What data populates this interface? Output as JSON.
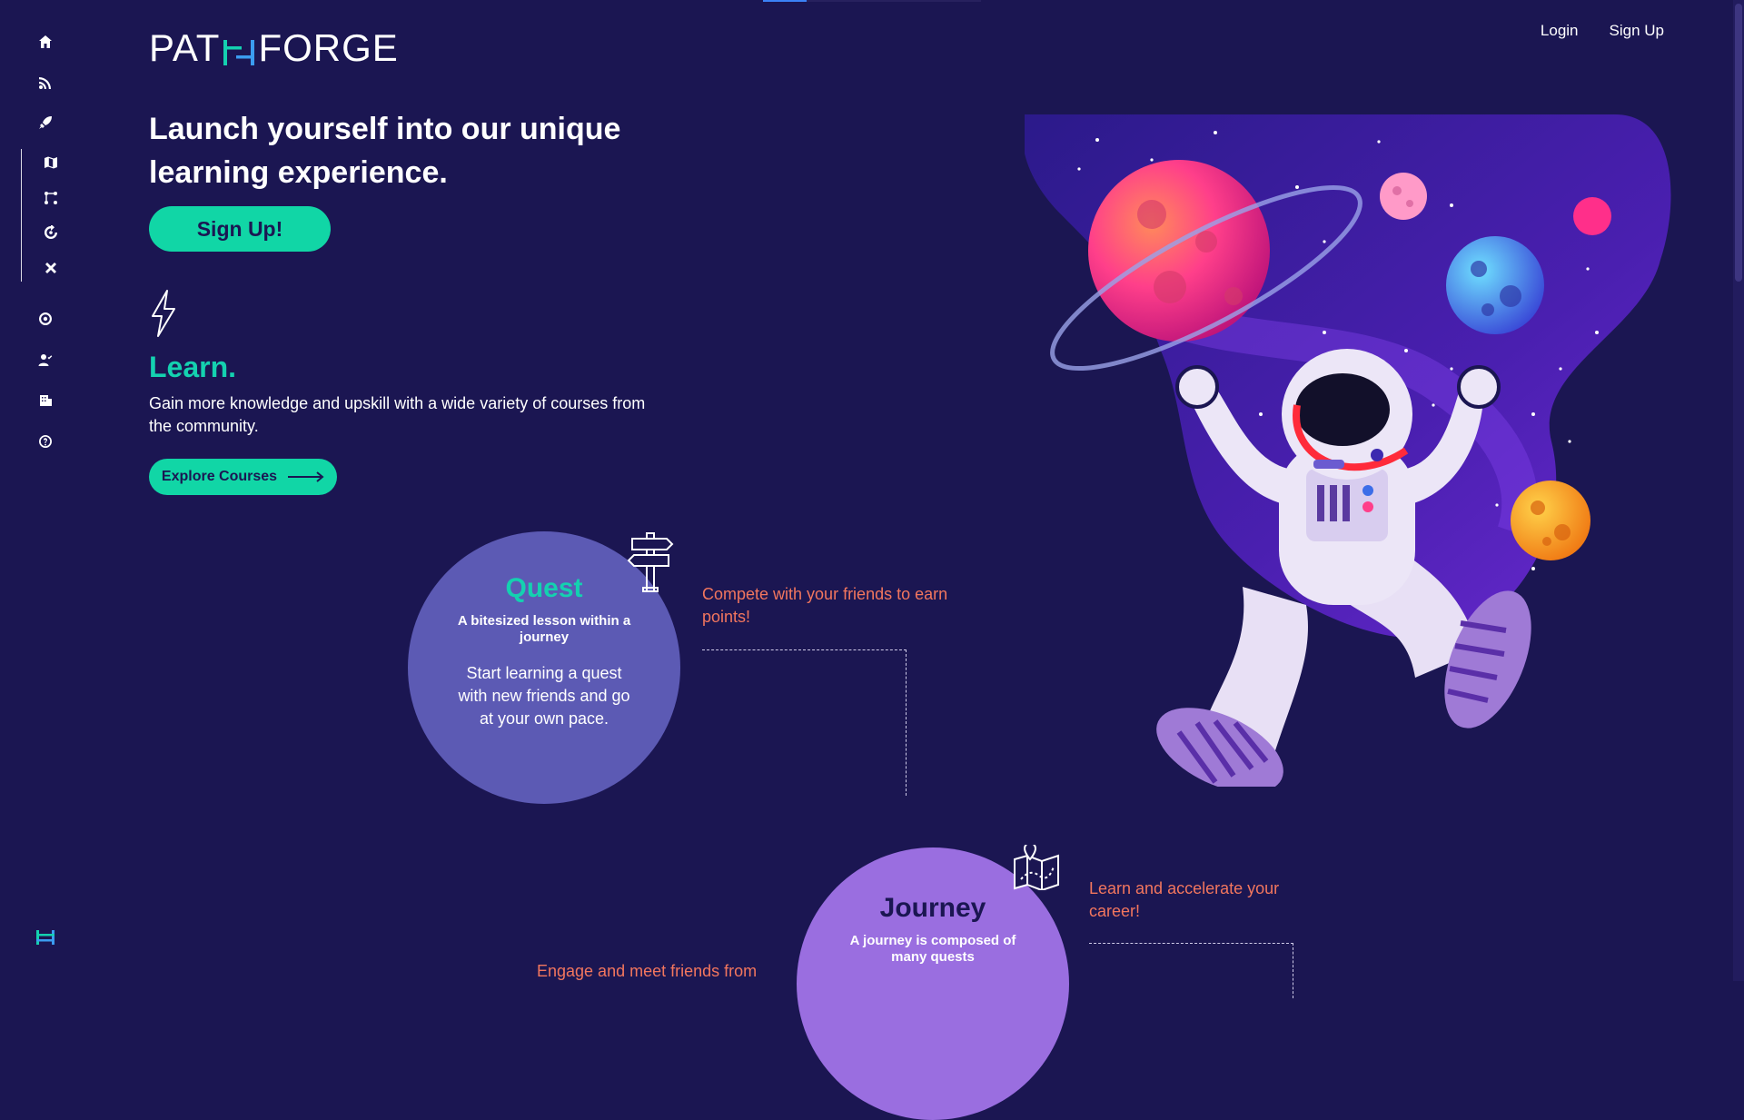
{
  "brand": {
    "logo_left": "PAT",
    "logo_right": "FORGE"
  },
  "nav": {
    "login": "Login",
    "signup": "Sign Up"
  },
  "sidebar": {
    "items": [
      {
        "icon": "home-icon"
      },
      {
        "icon": "rss-icon"
      },
      {
        "icon": "rocket-icon"
      },
      {
        "icon": "map-icon"
      },
      {
        "icon": "path-icon"
      },
      {
        "icon": "refresh-icon"
      },
      {
        "icon": "tools-icon"
      },
      {
        "icon": "target-icon"
      },
      {
        "icon": "user-check-icon"
      },
      {
        "icon": "building-icon"
      },
      {
        "icon": "help-icon"
      }
    ],
    "bottom_logo": "pathforge-mark-icon"
  },
  "hero": {
    "title": "Launch yourself into our unique learning experience.",
    "cta": "Sign Up!"
  },
  "learn": {
    "title": "Learn.",
    "text": "Gain more knowledge and upskill with a wide variety of courses from the community.",
    "cta": "Explore Courses"
  },
  "quest": {
    "title": "Quest",
    "subtitle": "A bitesized lesson within a journey",
    "description": "Start learning a quest with new friends and go at your own pace.",
    "note": "Compete with your friends to earn points!"
  },
  "journey": {
    "title": "Journey",
    "subtitle": "A journey is composed of many quests",
    "note": "Learn and accelerate your career!"
  },
  "community": {
    "note": "Engage and meet friends from"
  },
  "colors": {
    "background": "#1b1652",
    "accent": "#11d6a6",
    "note": "#f2765e",
    "quest_circle": "#5c5ab4",
    "journey_circle": "#9a6ee0"
  }
}
